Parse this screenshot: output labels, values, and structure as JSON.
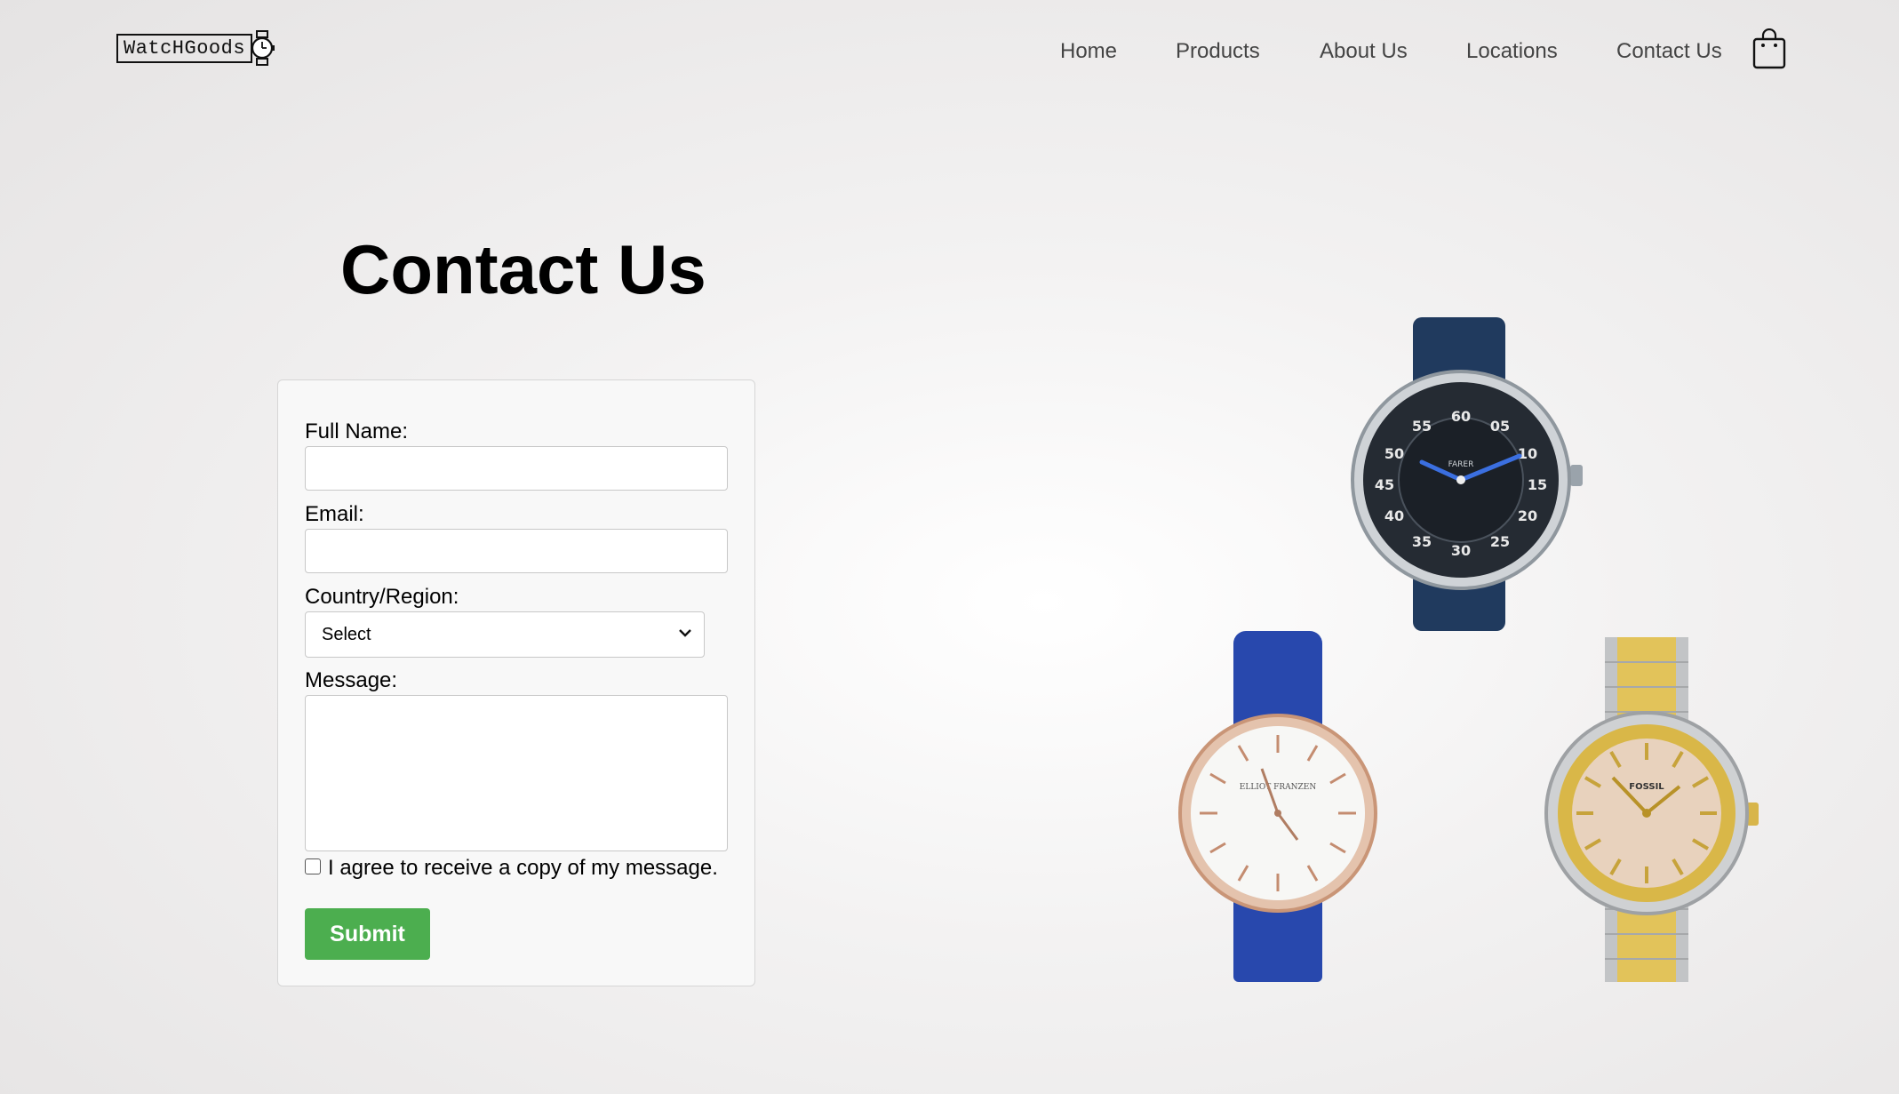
{
  "brand": {
    "logo_text": "WatcHGoods"
  },
  "nav": {
    "items": [
      {
        "label": "Home"
      },
      {
        "label": "Products"
      },
      {
        "label": "About Us"
      },
      {
        "label": "Locations"
      },
      {
        "label": "Contact Us"
      }
    ],
    "cart_icon": "shopping-bag-icon"
  },
  "page": {
    "title": "Contact Us"
  },
  "form": {
    "full_name_label": "Full Name:",
    "full_name_value": "",
    "email_label": "Email:",
    "email_value": "",
    "country_label": "Country/Region:",
    "country_selected": "Select",
    "message_label": "Message:",
    "message_value": "",
    "copy_checkbox_label": "I agree to receive a copy of my message.",
    "copy_checkbox_checked": false,
    "submit_label": "Submit"
  },
  "colors": {
    "submit_bg": "#4cae4f",
    "watch1_strap": "#1f3a5c",
    "watch2_strap": "#2747a8",
    "watch3_gold": "#d8b54a"
  },
  "watches": [
    {
      "brand_text": "FARER",
      "dial_numbers": [
        "60",
        "05",
        "10",
        "15",
        "20",
        "25",
        "30",
        "35",
        "40",
        "45",
        "50",
        "55"
      ]
    },
    {
      "brand_text": "ELLIOT FRANZEN"
    },
    {
      "brand_text": "FOSSIL"
    }
  ]
}
